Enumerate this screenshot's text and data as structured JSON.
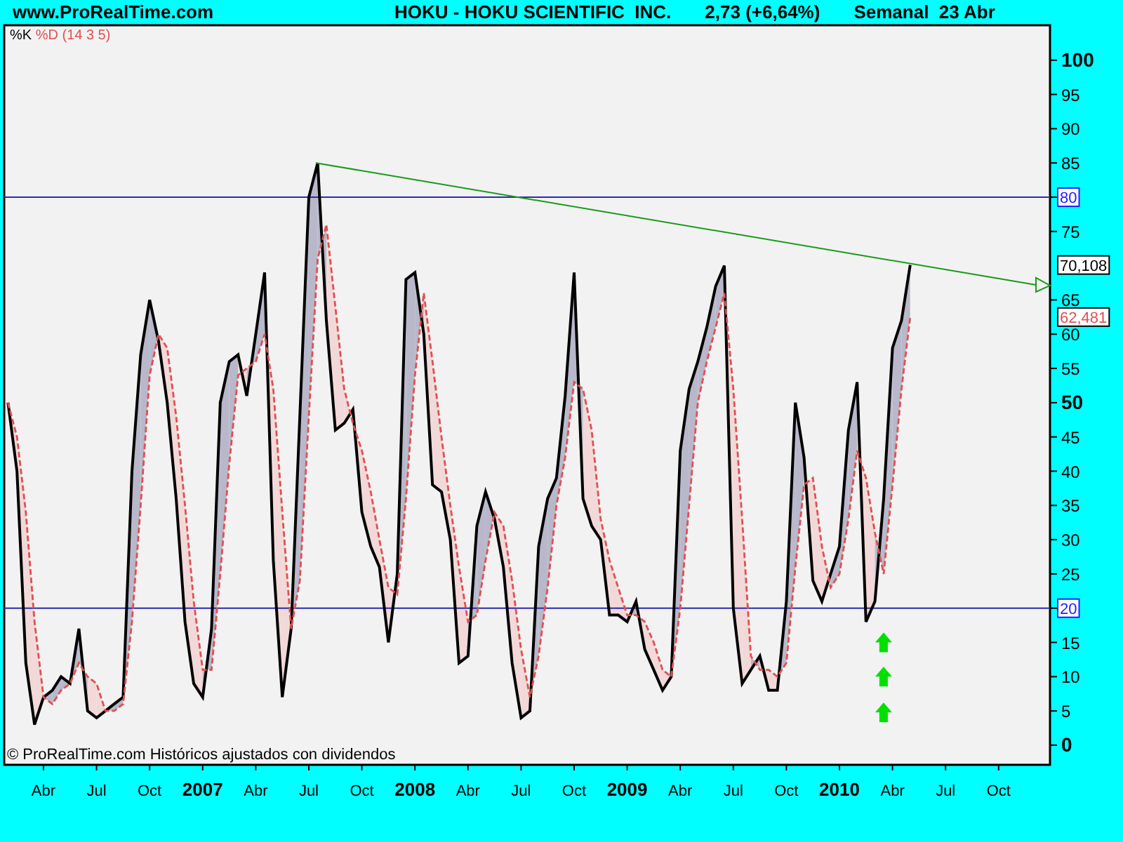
{
  "header": {
    "site": "www.ProRealTime.com",
    "instrument": "HOKU - HOKU SCIENTIFIC  INC.",
    "price": "2,73 (+6,64%)",
    "period": "Semanal  23 Abr"
  },
  "chart": {
    "legend_parameters": "(14 3 5)",
    "footer": "© ProRealTime.com  Históricos ajustados con dividendos",
    "last_value_labels": [
      "70,108",
      "62,481"
    ],
    "chart_data": {
      "type": "line",
      "xlim": [
        2006.065,
        2010.992
      ],
      "ylim": [
        -2.87,
        105.1
      ],
      "ref_lines": [
        {
          "axis": "y",
          "value": 80,
          "label": "80"
        },
        {
          "axis": "y",
          "value": 20,
          "label": "20"
        }
      ],
      "x": [
        2006.083,
        2006.125,
        2006.167,
        2006.208,
        2006.25,
        2006.292,
        2006.333,
        2006.375,
        2006.417,
        2006.458,
        2006.5,
        2006.542,
        2006.583,
        2006.625,
        2006.667,
        2006.708,
        2006.75,
        2006.792,
        2006.833,
        2006.875,
        2006.917,
        2006.958,
        2007,
        2007.042,
        2007.083,
        2007.125,
        2007.167,
        2007.208,
        2007.25,
        2007.292,
        2007.333,
        2007.375,
        2007.417,
        2007.458,
        2007.5,
        2007.542,
        2007.583,
        2007.625,
        2007.667,
        2007.708,
        2007.75,
        2007.792,
        2007.833,
        2007.875,
        2007.917,
        2007.958,
        2008,
        2008.042,
        2008.083,
        2008.125,
        2008.167,
        2008.208,
        2008.25,
        2008.292,
        2008.333,
        2008.375,
        2008.417,
        2008.458,
        2008.5,
        2008.542,
        2008.583,
        2008.625,
        2008.667,
        2008.708,
        2008.75,
        2008.792,
        2008.833,
        2008.875,
        2008.917,
        2008.958,
        2009,
        2009.042,
        2009.083,
        2009.125,
        2009.167,
        2009.208,
        2009.25,
        2009.292,
        2009.333,
        2009.375,
        2009.417,
        2009.458,
        2009.5,
        2009.542,
        2009.583,
        2009.625,
        2009.667,
        2009.708,
        2009.75,
        2009.792,
        2009.833,
        2009.875,
        2009.917,
        2009.958,
        2010,
        2010.042,
        2010.083,
        2010.125,
        2010.167,
        2010.208,
        2010.25,
        2010.292,
        2010.333
      ],
      "series": [
        {
          "name": "%K",
          "color": "#000000",
          "values": [
            50,
            40,
            12,
            3,
            7,
            8,
            10,
            9,
            17,
            5,
            4,
            5,
            6,
            7,
            40,
            57,
            65,
            59,
            50,
            36,
            18,
            9,
            7,
            17,
            50,
            56,
            57,
            51,
            60,
            69,
            27,
            7,
            17,
            48,
            80,
            85,
            62,
            46,
            47,
            49,
            34,
            29,
            26,
            15,
            25,
            68,
            69,
            60,
            38,
            37,
            30,
            12,
            13,
            32,
            37,
            33,
            26,
            12,
            4,
            5,
            29,
            36,
            39,
            51,
            69,
            36,
            32,
            30,
            19,
            19,
            18,
            21,
            14,
            11,
            8,
            10,
            43,
            52,
            56,
            61,
            67,
            70,
            20,
            9,
            11,
            13,
            8,
            8,
            21,
            50,
            42,
            24,
            21,
            25,
            29,
            46,
            53,
            18,
            21,
            36,
            58,
            62,
            70.1
          ]
        },
        {
          "name": "%D",
          "color": "#e05050",
          "line_style": "dashed",
          "values": [
            50,
            45,
            34,
            18,
            7,
            6,
            8,
            9,
            12,
            10,
            9,
            5,
            5,
            6,
            18,
            35,
            54,
            60,
            58,
            48,
            35,
            21,
            11,
            11,
            25,
            41,
            54,
            55,
            56,
            60,
            52,
            34,
            17,
            24,
            48,
            71,
            76,
            64,
            52,
            47,
            43,
            37,
            30,
            23,
            22,
            36,
            54,
            66,
            56,
            45,
            35,
            26,
            18,
            19,
            27,
            34,
            32,
            24,
            14,
            7,
            13,
            23,
            35,
            42,
            53,
            52,
            46,
            33,
            27,
            23,
            19,
            19,
            18,
            15,
            11,
            10,
            20,
            35,
            50,
            56,
            61,
            66,
            52,
            33,
            13,
            11,
            11,
            10,
            12,
            26,
            38,
            39,
            29,
            23,
            25,
            33,
            43,
            39,
            31,
            25,
            38,
            52,
            62.5
          ]
        }
      ],
      "yticks": [
        0,
        5,
        10,
        15,
        20,
        25,
        30,
        35,
        40,
        45,
        50,
        55,
        60,
        65,
        75,
        80,
        85,
        90,
        95,
        100
      ],
      "xticks": [
        {
          "value": 2006.25,
          "label": "Abr"
        },
        {
          "value": 2006.5,
          "label": "Jul"
        },
        {
          "value": 2006.75,
          "label": "Oct"
        },
        2007,
        {
          "value": 2007.25,
          "label": "Abr"
        },
        {
          "value": 2007.5,
          "label": "Jul"
        },
        {
          "value": 2007.75,
          "label": "Oct"
        },
        2008,
        {
          "value": 2008.25,
          "label": "Abr"
        },
        {
          "value": 2008.5,
          "label": "Jul"
        },
        {
          "value": 2008.75,
          "label": "Oct"
        },
        2009,
        {
          "value": 2009.25,
          "label": "Abr"
        },
        {
          "value": 2009.5,
          "label": "Jul"
        },
        {
          "value": 2009.75,
          "label": "Oct"
        },
        2010,
        {
          "value": 2010.25,
          "label": "Abr"
        },
        {
          "value": 2010.5,
          "label": "Jul"
        },
        {
          "value": 2010.75,
          "label": "Oct"
        }
      ]
    }
  }
}
